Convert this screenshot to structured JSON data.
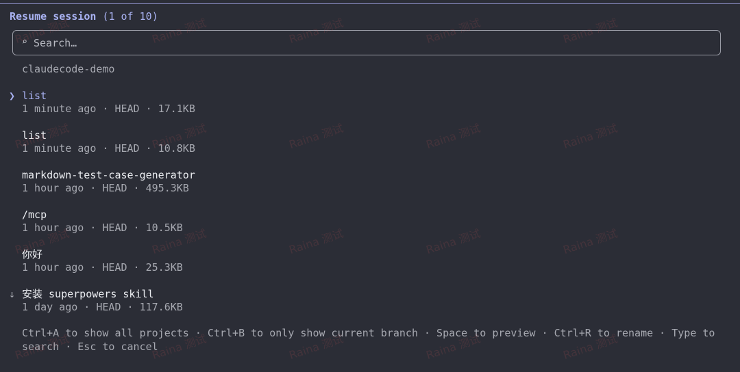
{
  "header": {
    "title": "Resume session",
    "count": "(1 of 10)"
  },
  "search": {
    "icon": "search-icon",
    "placeholder": "Search…"
  },
  "group_label": "claudecode-demo",
  "sessions": [
    {
      "name": "list",
      "meta": "1 minute ago · HEAD · 17.1KB",
      "selected": true
    },
    {
      "name": "list",
      "meta": "1 minute ago · HEAD · 10.8KB",
      "selected": false
    },
    {
      "name": "markdown-test-case-generator",
      "meta": "1 hour ago · HEAD · 495.3KB",
      "selected": false
    },
    {
      "name": "/mcp",
      "meta": "1 hour ago · HEAD · 10.5KB",
      "selected": false
    },
    {
      "name": "你好",
      "meta": "1 hour ago · HEAD · 25.3KB",
      "selected": false
    },
    {
      "name": "安装 superpowers skill",
      "meta": "1 day ago · HEAD · 117.6KB",
      "selected": false
    }
  ],
  "markers": {
    "selected": "❯",
    "more_below": "↓"
  },
  "footer": {
    "hint": "Ctrl+A to show all projects · Ctrl+B to only show current branch · Space to preview · Ctrl+R to rename · Type to search · Esc to cancel"
  },
  "watermark": "Raina 测试",
  "colors": {
    "background": "#2b2d36",
    "accent": "#a9b2f2",
    "text": "#eceef2",
    "muted": "#a7a9b1",
    "border": "#9a9ca6"
  }
}
